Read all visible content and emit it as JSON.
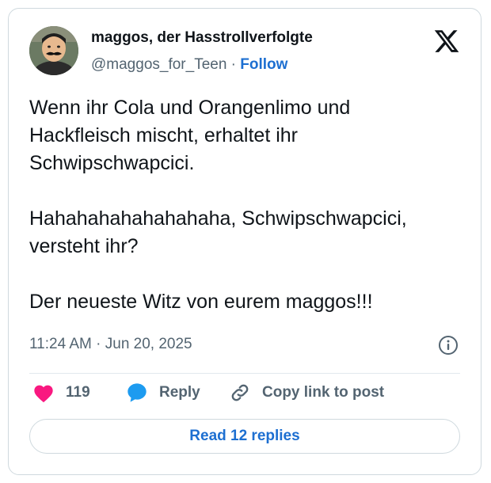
{
  "author": {
    "display_name": "maggos, der Hasstrollverfolgte",
    "handle": "@maggos_for_Teen",
    "separator": "·",
    "follow_label": "Follow"
  },
  "tweet": {
    "paragraphs": [
      "Wenn ihr Cola und Orangenlimo und Hackfleisch mischt, erhaltet ihr Schwipschwapcici.",
      "Hahahahahahahahaha, Schwipschwapcici, versteht ihr?",
      "Der neueste Witz von eurem maggos!!!"
    ],
    "timestamp": "11:24 AM · Jun 20, 2025"
  },
  "actions": {
    "like_count": "119",
    "reply_label": "Reply",
    "copy_label": "Copy link to post"
  },
  "footer": {
    "read_replies_label": "Read 12 replies"
  },
  "icons": {
    "platform": "x-logo-icon",
    "info": "info-icon",
    "like": "heart-icon",
    "reply": "speech-bubble-icon",
    "copy": "link-icon"
  },
  "colors": {
    "like": "#f91880",
    "reply": "#1d9bf0",
    "link": "#1d6fd1",
    "muted": "#536471",
    "text": "#0f1419",
    "border": "#cfd9de"
  }
}
